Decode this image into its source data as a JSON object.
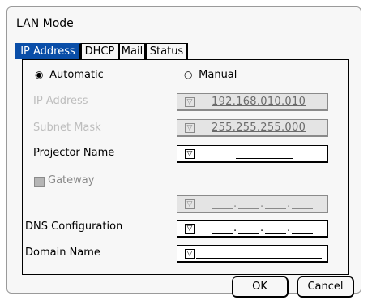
{
  "window": {
    "title": "LAN Mode"
  },
  "tabs": [
    {
      "label": "IP Address",
      "active": true
    },
    {
      "label": "DHCP",
      "active": false
    },
    {
      "label": "Mail",
      "active": false
    },
    {
      "label": "Status",
      "active": false
    }
  ],
  "mode": {
    "automatic_label": "Automatic",
    "manual_label": "Manual",
    "selected": "Automatic",
    "selected_glyph": "◉",
    "unselected_glyph": "○"
  },
  "fields": {
    "ip_address": {
      "label": "IP Address",
      "value": "192.168.010.010",
      "enabled": false
    },
    "subnet_mask": {
      "label": "Subnet Mask",
      "value": "255.255.255.000",
      "enabled": false
    },
    "projector_name": {
      "label": "Projector Name",
      "value": "",
      "enabled": true
    },
    "gateway": {
      "label": "Gateway",
      "checked": false,
      "enabled": false,
      "value": "",
      "segment_separator": "."
    },
    "dns_configuration": {
      "label": "DNS Configuration",
      "value": "",
      "segment_separator": ".",
      "enabled": true
    },
    "domain_name": {
      "label": "Domain Name",
      "value": "",
      "enabled": true
    }
  },
  "dropdown_glyph": "▽",
  "buttons": {
    "ok": "OK",
    "cancel": "Cancel"
  },
  "colors": {
    "tab_active": "#0a4ea8",
    "disabled_text": "#bdbdbd",
    "disabled_field": "#e4e4e4"
  }
}
